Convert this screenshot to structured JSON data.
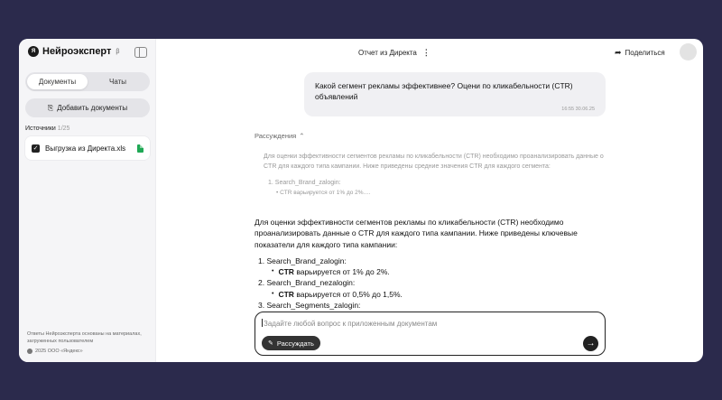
{
  "sidebar": {
    "logo_text": "Нейроэксперт",
    "logo_sup": "β",
    "logo_mark": "Я",
    "tabs": [
      {
        "label": "Документы"
      },
      {
        "label": "Чаты"
      }
    ],
    "add_docs_label": "Добавить документы",
    "sources_label": "Источники",
    "sources_count": "1/25",
    "files": [
      {
        "name": "Выгрузка из Директа.xls"
      }
    ],
    "footer_note": "Ответы Нейроэксперта основаны на материалах, загруженных пользователем",
    "copyright": "2025 ООО «Яндекс»"
  },
  "header": {
    "title": "Отчет из Директа",
    "share_label": "Поделиться"
  },
  "chat": {
    "user_message": "Какой сегмент рекламы эффективнее? Оцени по кликабельности (CTR) объявлений",
    "user_time": "16:55 30.06.25",
    "reasoning_label": "Рассуждения",
    "reasoning_text": "Для оценки эффективности сегментов рекламы по кликабельности (CTR) необходимо проанализировать данные о CTR для каждого типа кампании. Ниже приведены средние значения CTR для каждого сегмента:",
    "reasoning_item": "1. Search_Brand_zalogin:",
    "reasoning_subitem": "CTR варьируется от 1% до 2%.…",
    "answer_intro": "Для оценки эффективности сегментов рекламы по кликабельности (CTR) необходимо проанализировать данные о CTR для каждого типа кампании. Ниже приведены ключевые показатели для каждого типа кампании:",
    "items": [
      {
        "title": "1. Search_Brand_zalogin:",
        "ctr_label": "CTR",
        "ctr_text": "варьируется от 1% до 2%."
      },
      {
        "title": "2. Search_Brand_nezalogin:",
        "ctr_label": "CTR",
        "ctr_text": "варьируется от 0,5% до 1,5%."
      },
      {
        "title": "3. Search_Segments_zalogin:",
        "ctr_label": "",
        "ctr_text": ""
      }
    ]
  },
  "input": {
    "placeholder": "Задайте любой вопрос к приложенным документам",
    "reason_button": "Рассуждать"
  }
}
